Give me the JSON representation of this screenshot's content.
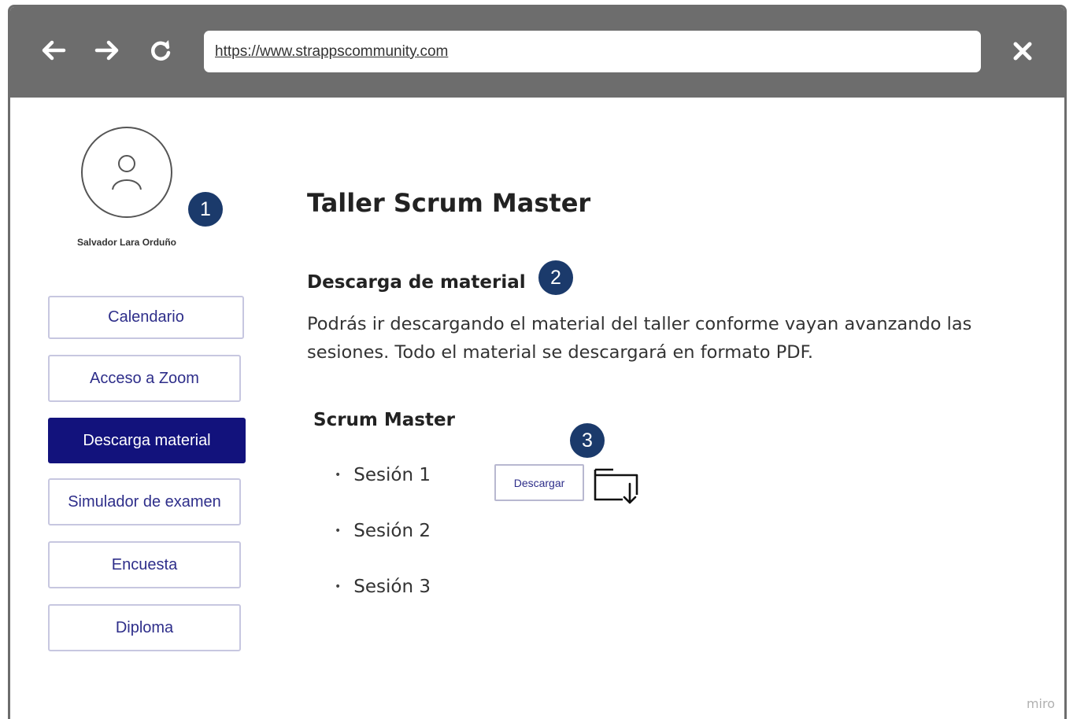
{
  "browser": {
    "url": "https://www.strappscommunity.com",
    "back_icon": "arrow-left-icon",
    "forward_icon": "arrow-right-icon",
    "reload_icon": "reload-icon",
    "close_icon": "close-icon"
  },
  "sidebar": {
    "user_name": "Salvador Lara Orduño",
    "avatar_icon": "user-icon",
    "items": [
      {
        "label": "Calendario",
        "active": false
      },
      {
        "label": "Acceso a Zoom",
        "active": false
      },
      {
        "label": "Descarga material",
        "active": true
      },
      {
        "label": "Simulador de examen",
        "active": false
      },
      {
        "label": "Encuesta",
        "active": false
      },
      {
        "label": "Diploma",
        "active": false
      }
    ]
  },
  "annotations": {
    "badge_1": "1",
    "badge_2": "2",
    "badge_3": "3"
  },
  "main": {
    "title": "Taller Scrum Master",
    "section_heading": "Descarga de material",
    "section_description": "Podrás ir descargando el material del taller conforme vayan avanzando las sesiones. Todo el material se descargará en formato PDF.",
    "subsection_title": "Scrum Master",
    "sessions": [
      {
        "label": "Sesión 1",
        "bullet": "•"
      },
      {
        "label": "Sesión 2",
        "bullet": "•"
      },
      {
        "label": "Sesión 3",
        "bullet": "•"
      }
    ],
    "download_label": "Descargar",
    "download_icon": "folder-download-icon"
  },
  "watermark": "miro",
  "colors": {
    "toolbar": "#6d6d6d",
    "active_nav": "#12127c",
    "badge": "#1b3a6b",
    "nav_text": "#2e2e8a"
  }
}
